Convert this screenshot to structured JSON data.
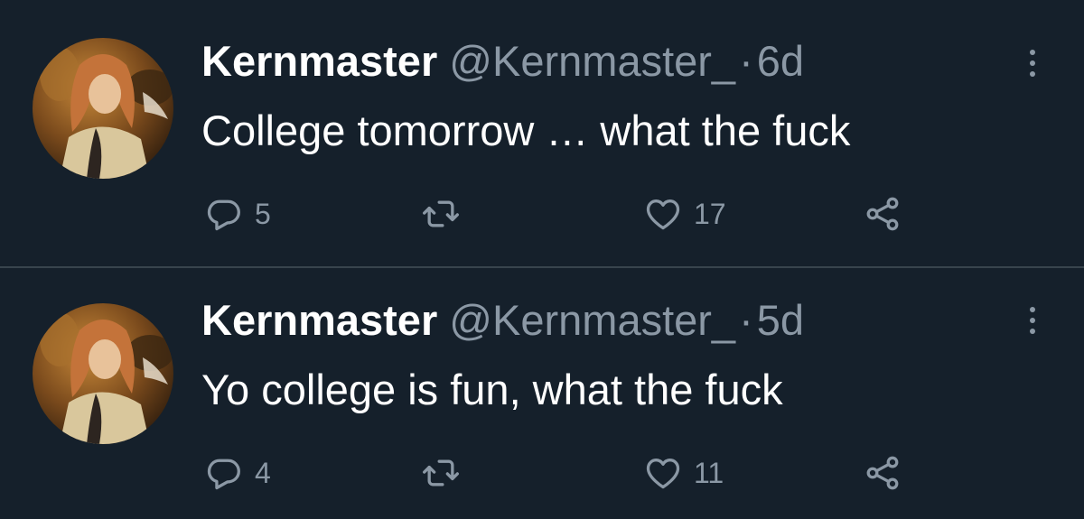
{
  "tweets": [
    {
      "name": "Kernmaster",
      "handle": "@Kernmaster_",
      "separator": "·",
      "time": "6d",
      "text": "College tomorrow … what the fuck",
      "reply_count": "5",
      "retweet_count": "",
      "like_count": "17"
    },
    {
      "name": "Kernmaster",
      "handle": "@Kernmaster_",
      "separator": "·",
      "time": "5d",
      "text": "Yo college is fun, what the fuck",
      "reply_count": "4",
      "retweet_count": "",
      "like_count": "11"
    }
  ],
  "icons": {
    "reply": "reply-icon",
    "retweet": "retweet-icon",
    "like": "heart-icon",
    "share": "share-icon",
    "more": "more-options-icon"
  },
  "colors": {
    "background": "#15202b",
    "divider": "#38444d",
    "primary_text": "#ffffff",
    "secondary_text": "#8b98a5"
  }
}
